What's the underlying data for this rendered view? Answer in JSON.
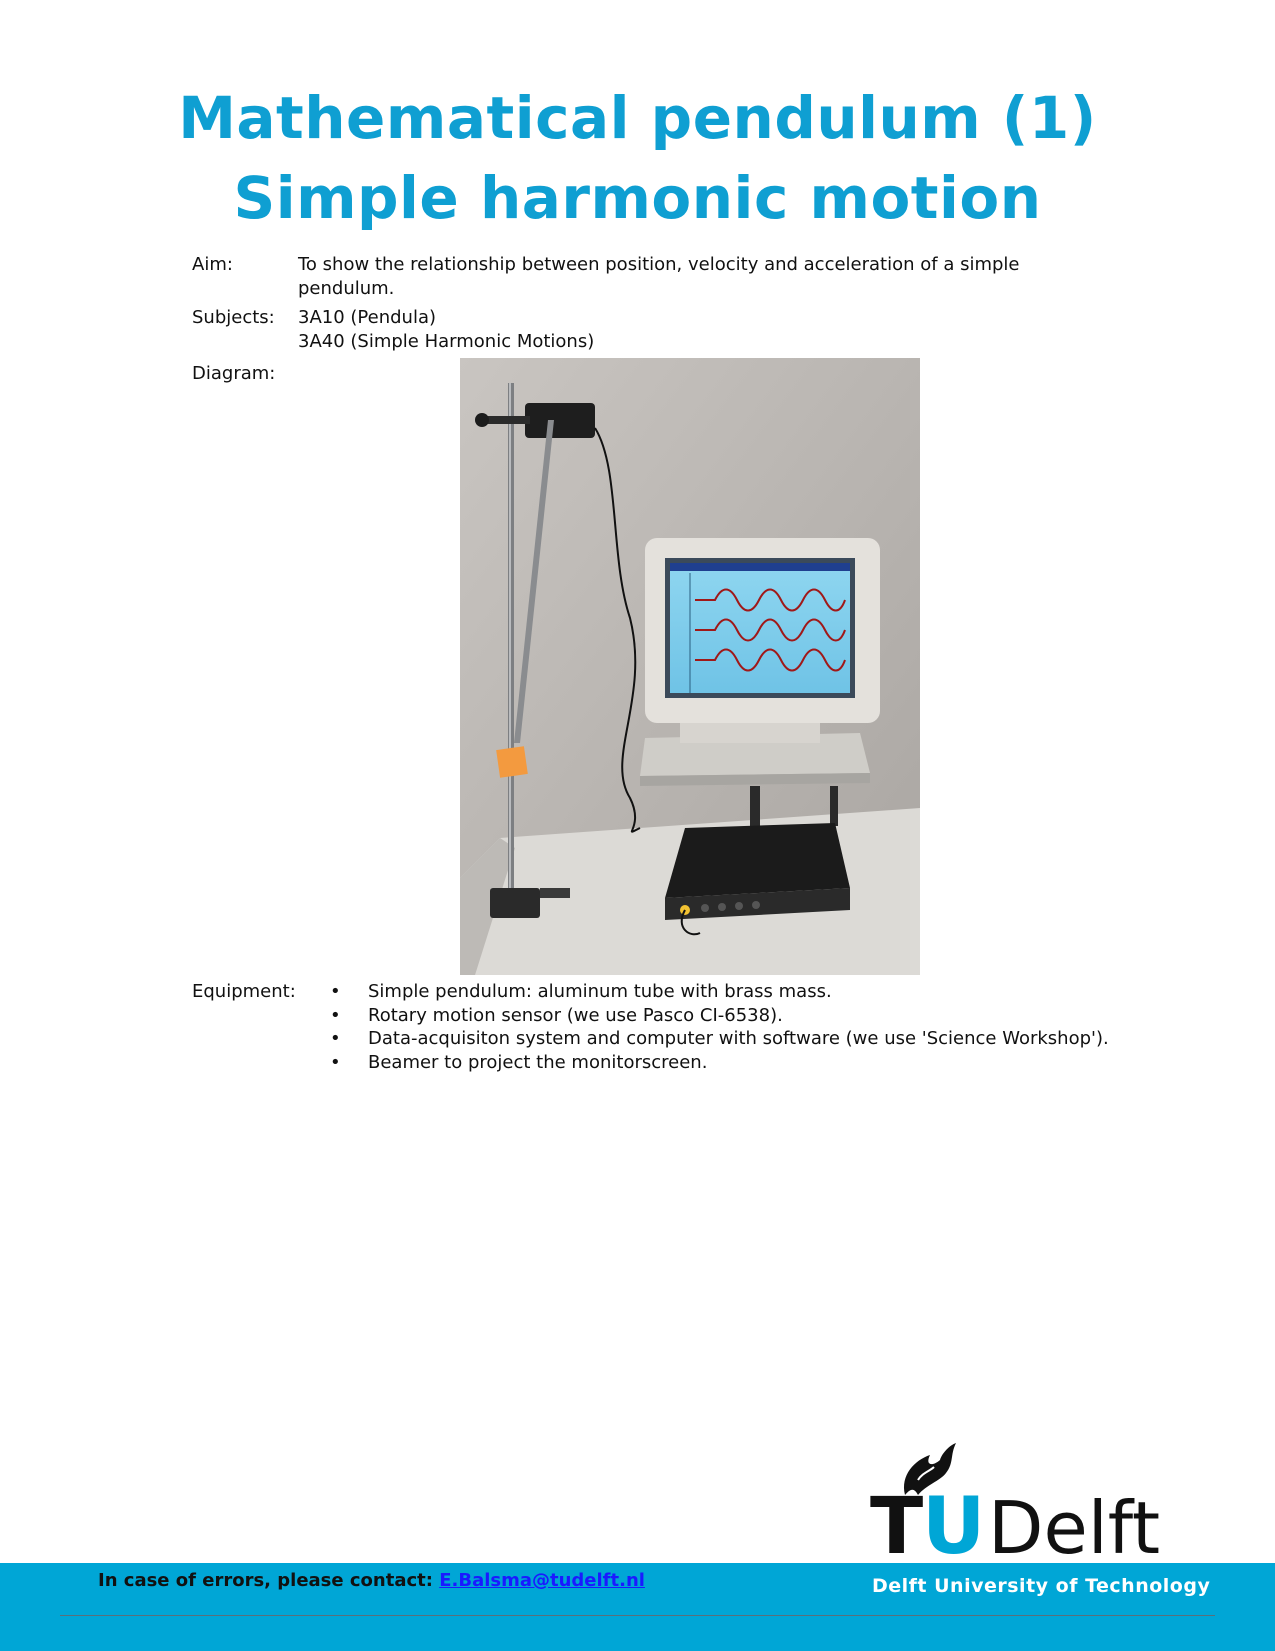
{
  "title": {
    "line1": "Mathematical pendulum (1)",
    "line2": "Simple harmonic motion"
  },
  "aim": {
    "label": "Aim:",
    "text_line1": "To show the relationship between position, velocity and acceleration of a simple",
    "text_line2": "pendulum."
  },
  "subjects": {
    "label": "Subjects:",
    "items": [
      "3A10 (Pendula)",
      "3A40 (Simple Harmonic Motions)"
    ]
  },
  "diagram": {
    "label": "Diagram:"
  },
  "equipment": {
    "label": "Equipment:",
    "bullet": "•",
    "items": [
      "Simple pendulum: aluminum tube with brass mass.",
      "Rotary motion sensor (we use Pasco CI-6538).",
      "Data-acquisiton system and computer with software (we use 'Science Workshop').",
      "Beamer to project the monitorscreen."
    ]
  },
  "logo": {
    "t": "T",
    "u": "U",
    "delft": "Delft"
  },
  "footer": {
    "contact_prefix": "In case of errors, please contact: ",
    "contact_email": "E.Balsma@tudelft.nl",
    "university": "Delft University of Technology"
  },
  "colors": {
    "title": "#0f9fd2",
    "footer_band": "#00a6d6",
    "logo_u": "#00a6d6"
  }
}
